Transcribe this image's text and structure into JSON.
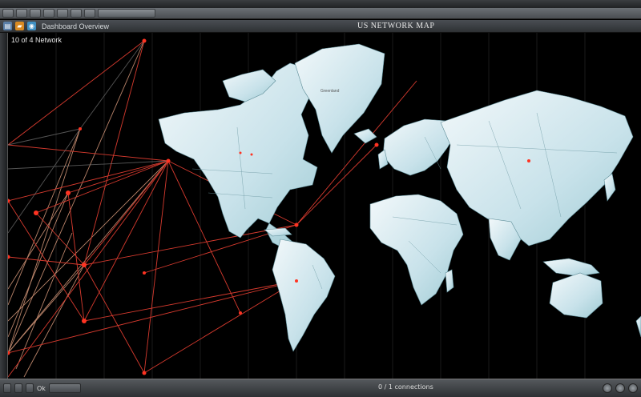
{
  "window": {
    "title": "US NETWORK MAP"
  },
  "menubar": {
    "label": "Dashboard Overview",
    "icons": [
      "document-icon",
      "folder-icon",
      "globe-icon"
    ]
  },
  "panel": {
    "label": "10 of 4 Network"
  },
  "map": {
    "region_label": "Greenland",
    "colors": {
      "land": "#e3eef2",
      "land_shade": "#9fcbd4",
      "ocean": "#000000",
      "link": "#d63a2e",
      "link_light": "#e8a585",
      "node": "#ff3322"
    }
  },
  "statusbar": {
    "left_text": "Ok",
    "center_text": "0 / 1 connections"
  }
}
